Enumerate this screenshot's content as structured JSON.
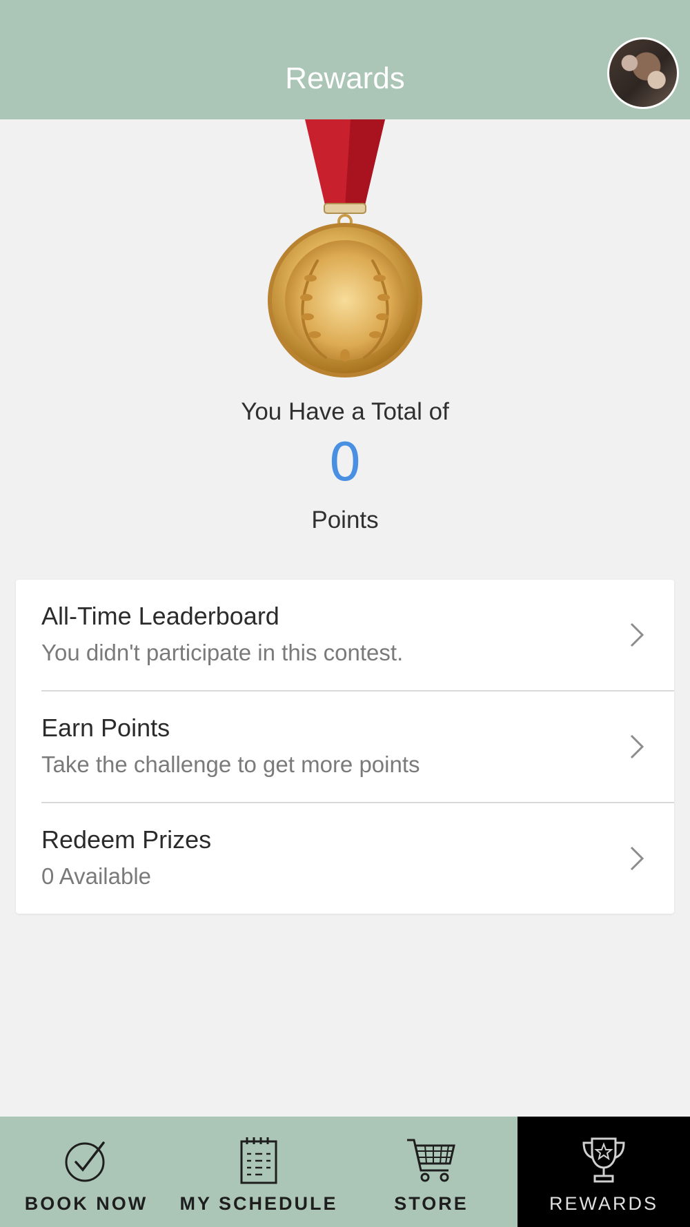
{
  "header": {
    "title": "Rewards",
    "avatar_icon": "user-avatar-photo"
  },
  "summary": {
    "total_label": "You Have a Total of",
    "points_value": "0",
    "points_unit": "Points",
    "points_color": "#4a90e2",
    "medal_icon": "gold-medal-icon"
  },
  "list": {
    "items": [
      {
        "title": "All-Time Leaderboard",
        "subtitle": "You didn't participate in this contest."
      },
      {
        "title": "Earn Points",
        "subtitle": "Take the challenge to get more points"
      },
      {
        "title": "Redeem Prizes",
        "subtitle": "0 Available"
      }
    ]
  },
  "nav": {
    "items": [
      {
        "label": "BOOK NOW",
        "icon": "check-circle-icon"
      },
      {
        "label": "MY SCHEDULE",
        "icon": "calendar-icon"
      },
      {
        "label": "STORE",
        "icon": "shopping-cart-icon"
      },
      {
        "label": "REWARDS",
        "icon": "trophy-icon",
        "active": true
      }
    ]
  },
  "colors": {
    "header_bg": "#abc6b6",
    "page_bg": "#f1f1f1",
    "active_tab_bg": "#000000"
  }
}
